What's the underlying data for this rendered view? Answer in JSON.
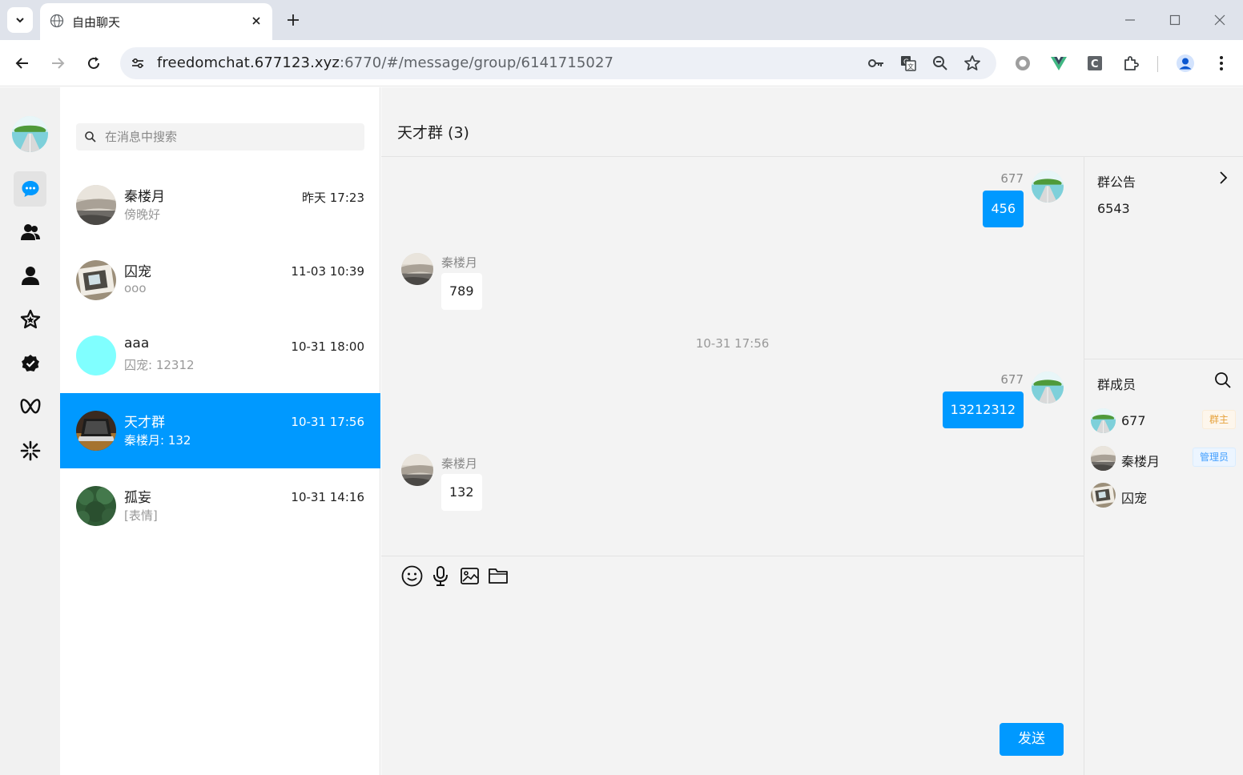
{
  "browser": {
    "tab_title": "自由聊天",
    "url_host": "freedomchat.677123.xyz",
    "url_rest": ":6770/#/message/group/6141715027"
  },
  "search": {
    "placeholder": "在消息中搜索"
  },
  "conversations": [
    {
      "name": "秦楼月",
      "preview": "傍晚好",
      "time": "昨天 17:23",
      "avatar": "road"
    },
    {
      "name": "囚宠",
      "preview": "ooo",
      "time": "11-03 10:39",
      "avatar": "photo"
    },
    {
      "name": "aaa",
      "preview": "囚宠: 12312",
      "time": "10-31 18:00",
      "avatar": "cyan"
    },
    {
      "name": "天才群",
      "preview": "秦楼月: 132",
      "time": "10-31 17:56",
      "avatar": "laptop",
      "active": true
    },
    {
      "name": "孤妄",
      "preview": "[表情]",
      "time": "10-31 14:16",
      "avatar": "forest"
    }
  ],
  "chat": {
    "title": "天才群 (3)",
    "messages": [
      {
        "sender": "677",
        "text": "456",
        "mine": true
      },
      {
        "sender": "秦楼月",
        "text": "789",
        "mine": false
      },
      {
        "divider": "10-31 17:56"
      },
      {
        "sender": "677",
        "text": "13212312",
        "mine": true
      },
      {
        "sender": "秦楼月",
        "text": "132",
        "mine": false
      }
    ],
    "send_label": "发送"
  },
  "side": {
    "notice_title": "群公告",
    "notice_text": "6543",
    "members_title": "群成员",
    "members": [
      {
        "name": "677",
        "role": "群主"
      },
      {
        "name": "秦楼月",
        "role": "管理员"
      },
      {
        "name": "囚宠",
        "role": ""
      }
    ]
  },
  "colors": {
    "accent": "#0099ff",
    "owner_badge": "#e6a23c",
    "admin_badge": "#409eff"
  }
}
